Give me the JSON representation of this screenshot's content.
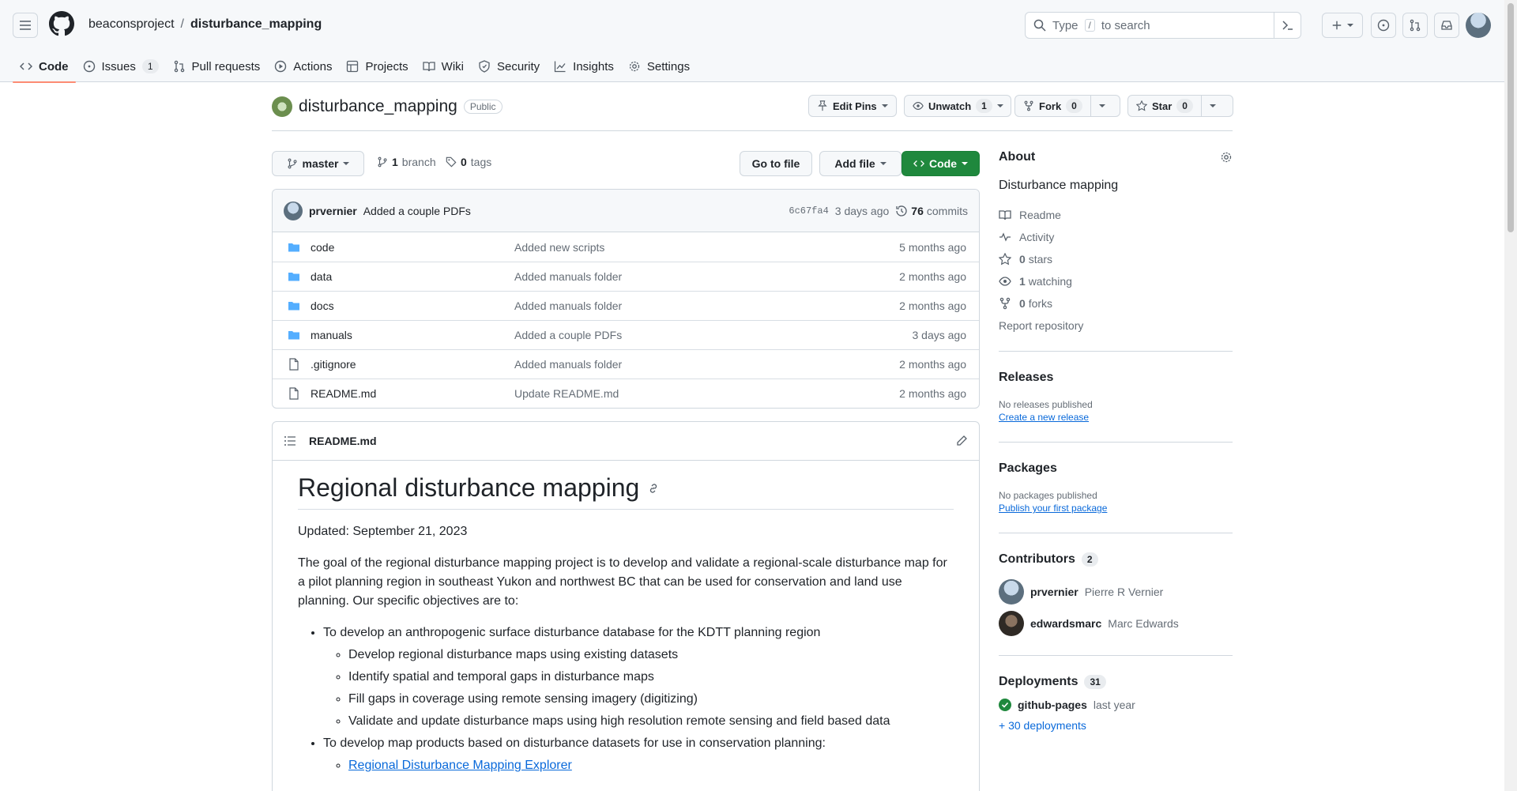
{
  "header": {
    "owner": "beaconsproject",
    "separator": "/",
    "repo": "disturbance_mapping",
    "search_before": "Type",
    "search_key": "/",
    "search_after": "to search"
  },
  "tabs": [
    {
      "label": "Code"
    },
    {
      "label": "Issues",
      "count": "1"
    },
    {
      "label": "Pull requests"
    },
    {
      "label": "Actions"
    },
    {
      "label": "Projects"
    },
    {
      "label": "Wiki"
    },
    {
      "label": "Security"
    },
    {
      "label": "Insights"
    },
    {
      "label": "Settings"
    }
  ],
  "repo": {
    "name": "disturbance_mapping",
    "visibility": "Public",
    "edit_pins": "Edit Pins",
    "unwatch": "Unwatch",
    "watch_count": "1",
    "fork": "Fork",
    "fork_count": "0",
    "star": "Star",
    "star_count": "0"
  },
  "toolbar": {
    "branch": "master",
    "branches_count": "1",
    "branches_label": "branch",
    "tags_count": "0",
    "tags_label": "tags",
    "go_to_file": "Go to file",
    "add_file": "Add file",
    "code": "Code"
  },
  "commit": {
    "author": "prvernier",
    "message": "Added a couple PDFs",
    "sha": "6c67fa4",
    "time": "3 days ago",
    "count": "76",
    "count_label": "commits"
  },
  "files": [
    {
      "type": "folder",
      "name": "code",
      "message": "Added new scripts",
      "age": "5 months ago"
    },
    {
      "type": "folder",
      "name": "data",
      "message": "Added manuals folder",
      "age": "2 months ago"
    },
    {
      "type": "folder",
      "name": "docs",
      "message": "Added manuals folder",
      "age": "2 months ago"
    },
    {
      "type": "folder",
      "name": "manuals",
      "message": "Added a couple PDFs",
      "age": "3 days ago"
    },
    {
      "type": "file",
      "name": ".gitignore",
      "message": "Added manuals folder",
      "age": "2 months ago"
    },
    {
      "type": "file",
      "name": "README.md",
      "message": "Update README.md",
      "age": "2 months ago"
    }
  ],
  "readme": {
    "filename": "README.md",
    "title": "Regional disturbance mapping",
    "updated": "Updated: September 21, 2023",
    "intro": "The goal of the regional disturbance mapping project is to develop and validate a regional-scale disturbance map for a pilot planning region in southeast Yukon and northwest BC that can be used for conservation and land use planning. Our specific objectives are to:",
    "objective1": "To develop an anthropogenic surface disturbance database for the KDTT planning region",
    "sub1": [
      "Develop regional disturbance maps using existing datasets",
      "Identify spatial and temporal gaps in disturbance maps",
      "Fill gaps in coverage using remote sensing imagery (digitizing)",
      "Validate and update disturbance maps using high resolution remote sensing and field based data"
    ],
    "objective2": "To develop map products based on disturbance datasets for use in conservation planning:",
    "link": "Regional Disturbance Mapping Explorer"
  },
  "about": {
    "heading": "About",
    "description": "Disturbance mapping",
    "readme": "Readme",
    "activity": "Activity",
    "stars_count": "0",
    "stars_label": "stars",
    "watching_count": "1",
    "watching_label": "watching",
    "forks_count": "0",
    "forks_label": "forks",
    "report": "Report repository"
  },
  "releases": {
    "heading": "Releases",
    "empty": "No releases published",
    "create": "Create a new release"
  },
  "packages": {
    "heading": "Packages",
    "empty": "No packages published",
    "publish": "Publish your first package"
  },
  "contributors": {
    "heading": "Contributors",
    "count": "2",
    "list": [
      {
        "login": "prvernier",
        "name": "Pierre R Vernier"
      },
      {
        "login": "edwardsmarc",
        "name": "Marc Edwards"
      }
    ]
  },
  "deployments": {
    "heading": "Deployments",
    "count": "31",
    "env": "github-pages",
    "time": "last year",
    "more": "+ 30 deployments"
  },
  "colors": {
    "accent": "#0969da",
    "green": "#1f883d",
    "tab_underline": "#fd8c73",
    "folder": "#54aeff"
  }
}
